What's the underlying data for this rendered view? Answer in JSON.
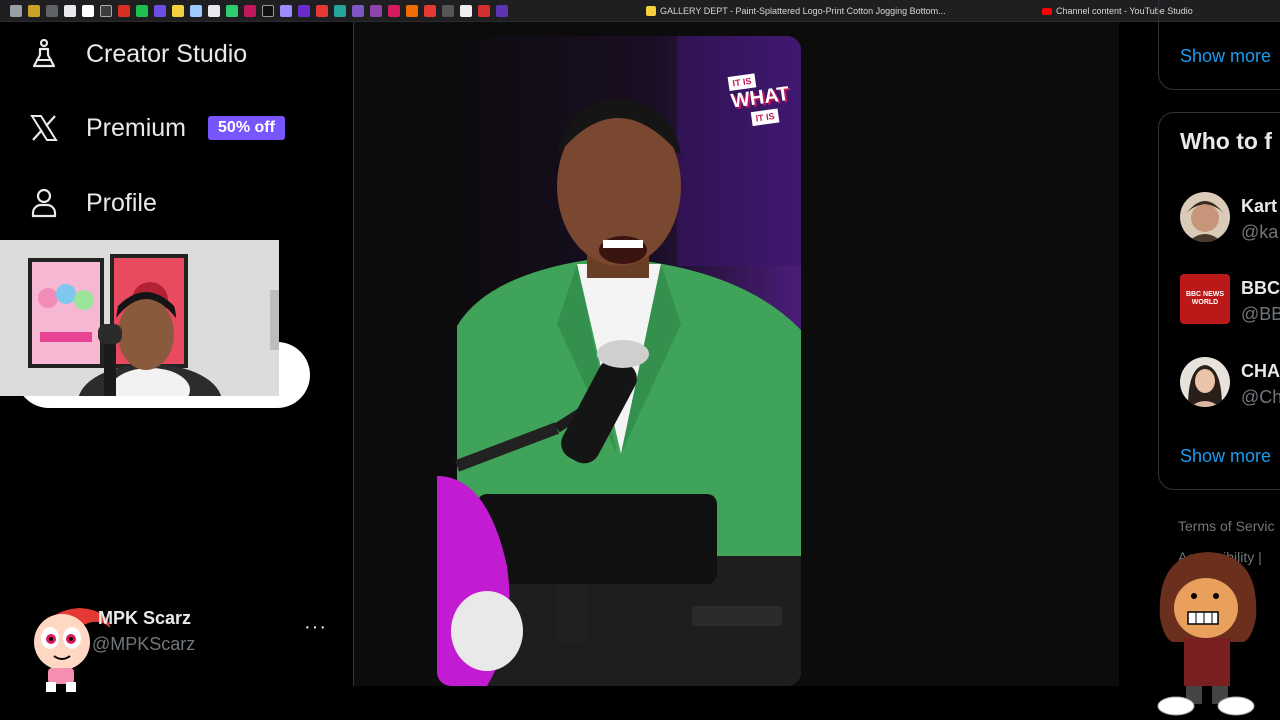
{
  "browser": {
    "tabs": [
      {
        "title": "GALLERY DEPT - Paint-Splattered Logo-Print Cotton Jogging Bottom...",
        "favicon": "gallery-dept-favicon"
      },
      {
        "title": "Channel content - YouTube Studio",
        "favicon": "youtube-favicon"
      }
    ]
  },
  "nav": {
    "creator_studio": "Creator Studio",
    "premium": "Premium",
    "premium_badge": "50% off",
    "profile": "Profile"
  },
  "account": {
    "name": "MPK Scarz",
    "handle": "@MPKScarz",
    "more": "···"
  },
  "video": {
    "watermark_line1": "IT IS",
    "watermark_line2": "WHAT",
    "watermark_line3": "IT IS"
  },
  "sidebar": {
    "show_more": "Show more",
    "who_to_follow": "Who to f",
    "suggestions": [
      {
        "name": "Kart",
        "handle": "@ka"
      },
      {
        "name": "BBC",
        "handle": "@BB",
        "avatar_text": "BBC NEWS WORLD"
      },
      {
        "name": "CHA",
        "handle": "@Ch"
      }
    ],
    "show_more_2": "Show more",
    "terms": "Terms of Servic",
    "accessibility": "Accessibility |"
  },
  "colors": {
    "accent": "#1d9bf0",
    "premium_badge": "#7856ff",
    "jacket": "#3fa35a"
  }
}
